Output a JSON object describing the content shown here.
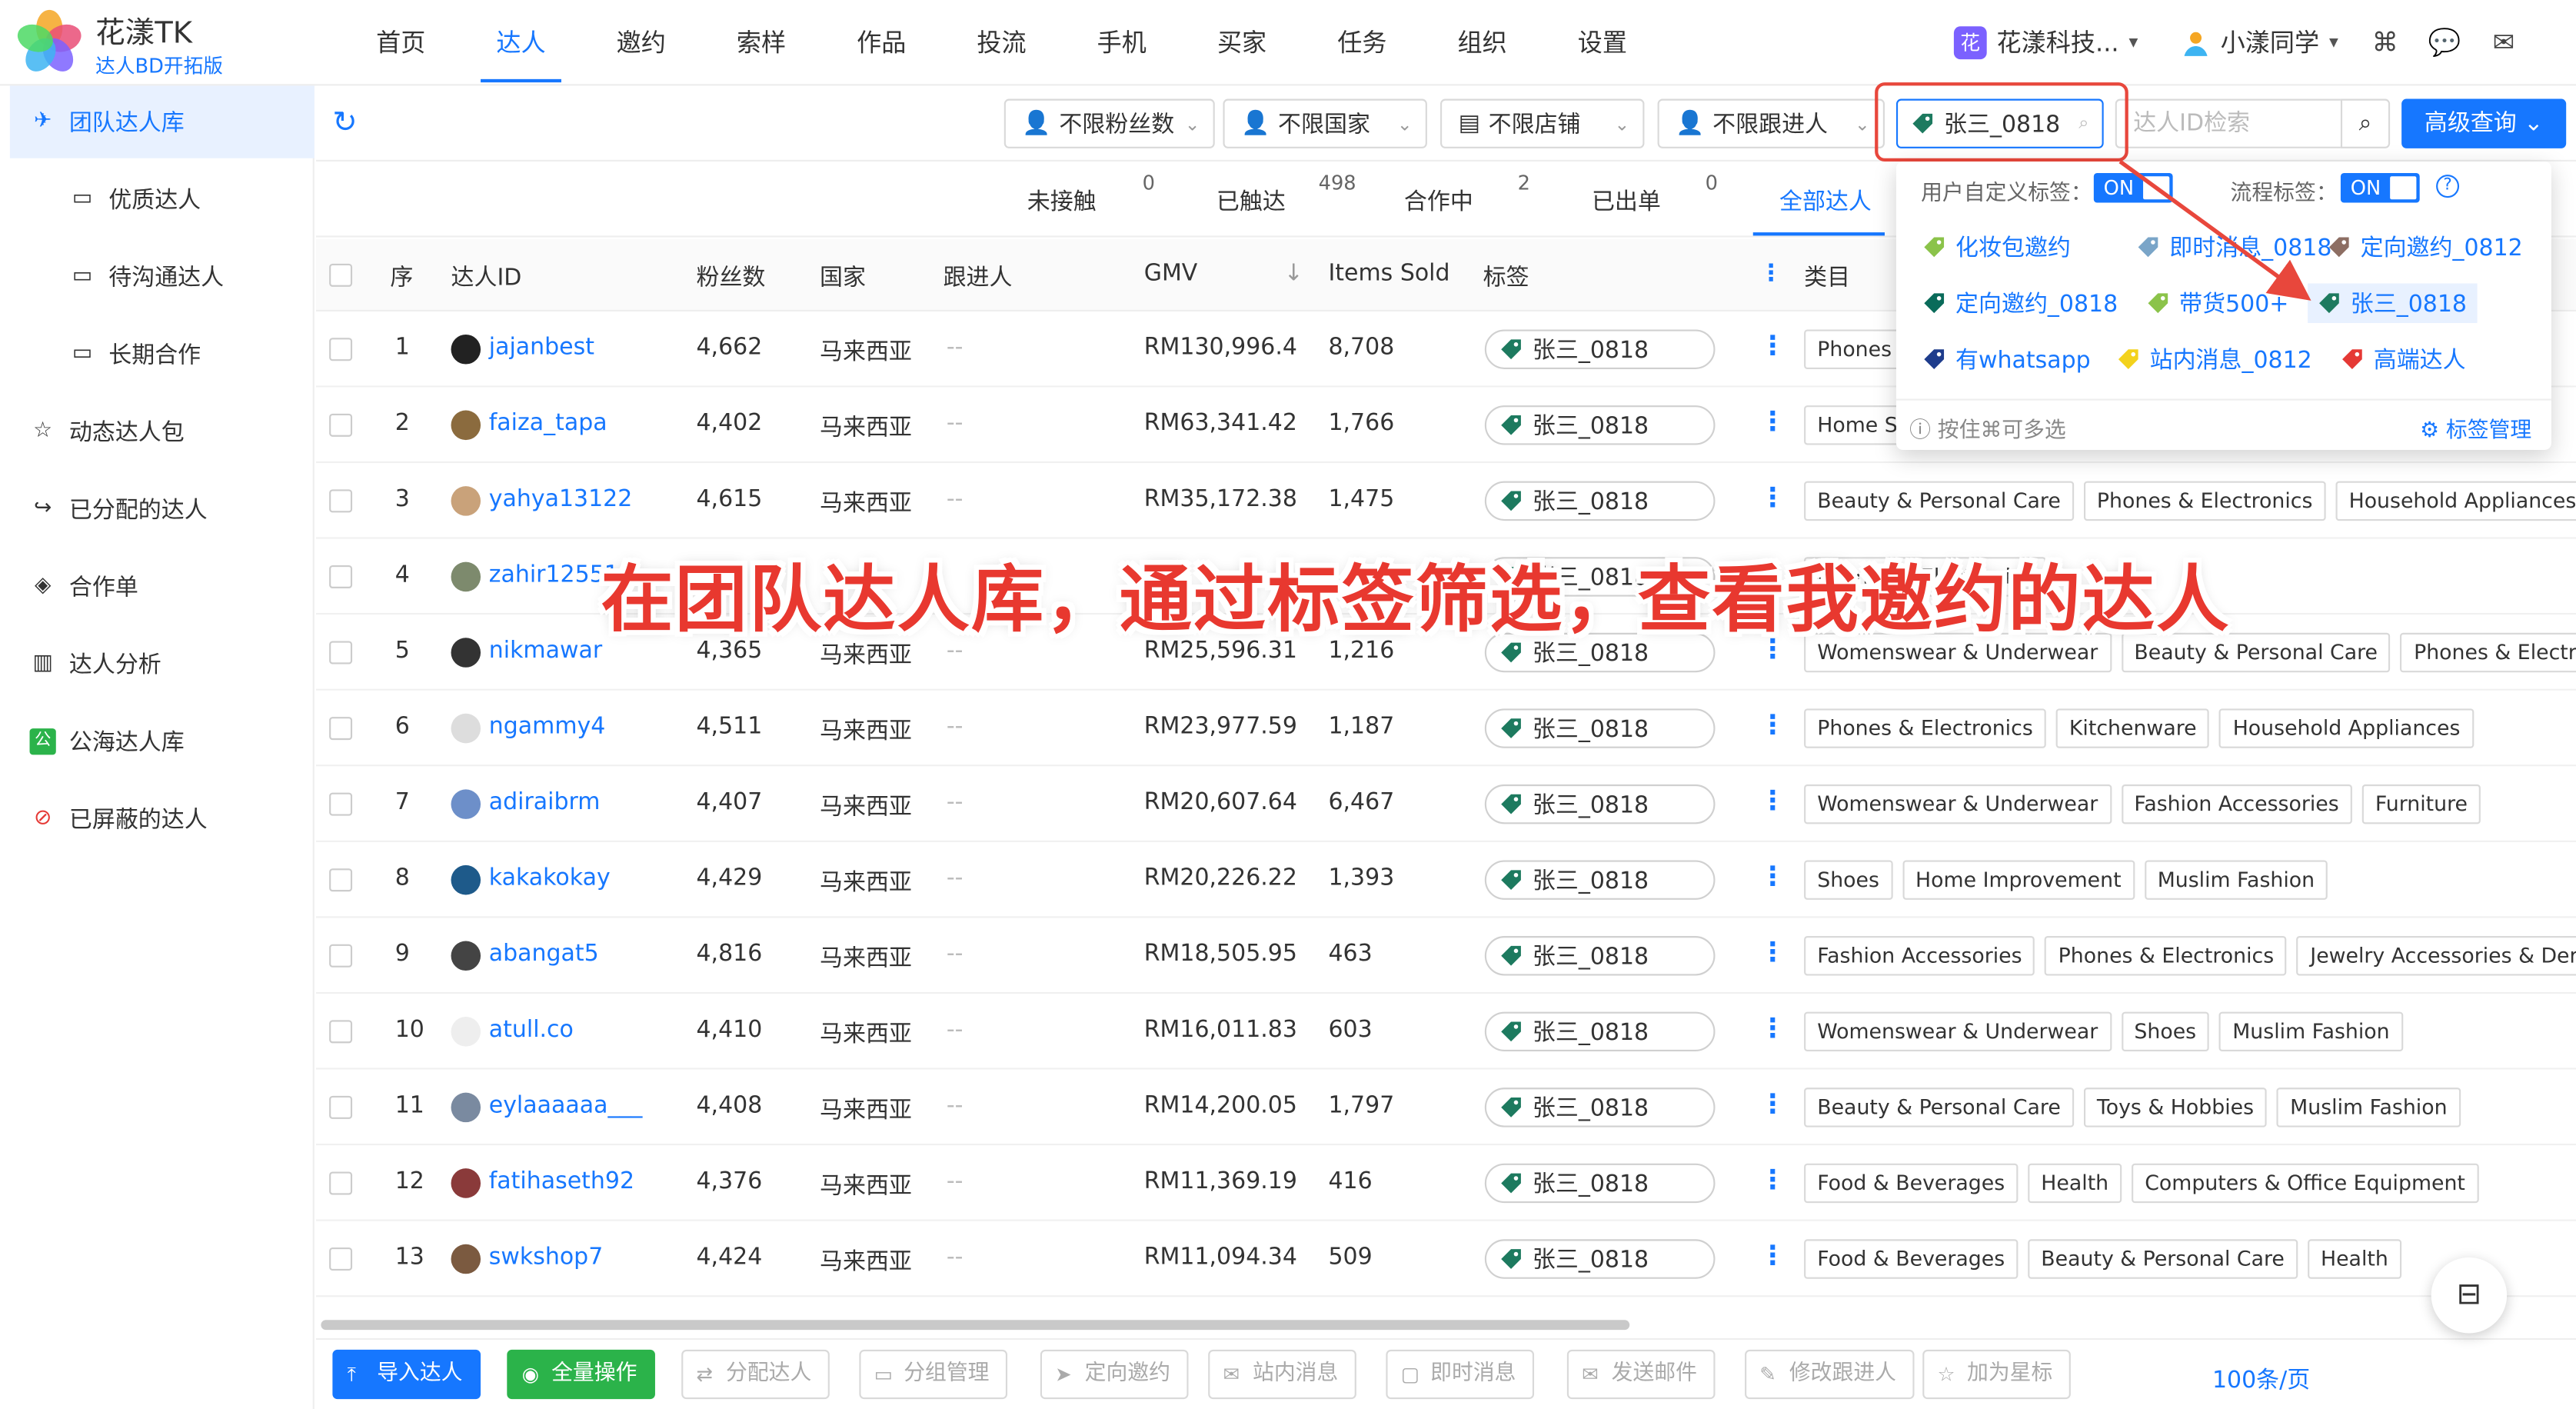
{
  "brand": {
    "title": "花漾TK",
    "subtitle": "达人BD开拓版"
  },
  "nav": [
    "首页",
    "达人",
    "邀约",
    "索样",
    "作品",
    "投流",
    "手机",
    "买家",
    "任务",
    "组织",
    "设置"
  ],
  "header": {
    "org_badge": "花",
    "org_name": "花漾科技...",
    "user_name": "小漾同学"
  },
  "sidebar": [
    {
      "label": "团队达人库",
      "icon": "plane-icon"
    },
    {
      "label": "优质达人",
      "icon": "folder-icon"
    },
    {
      "label": "待沟通达人",
      "icon": "folder-icon"
    },
    {
      "label": "长期合作",
      "icon": "folder-icon"
    },
    {
      "label": "动态达人包",
      "icon": "star-icon"
    },
    {
      "label": "已分配的达人",
      "icon": "share-icon"
    },
    {
      "label": "合作单",
      "icon": "handshake-icon"
    },
    {
      "label": "达人分析",
      "icon": "chart-icon"
    },
    {
      "label": "公海达人库",
      "icon": "public-icon"
    },
    {
      "label": "已屏蔽的达人",
      "icon": "block-icon"
    }
  ],
  "filters": {
    "followers": "不限粉丝数",
    "country": "不限国家",
    "store": "不限店铺",
    "owner": "不限跟进人",
    "tag_value": "张三_0818",
    "id_placeholder": "达人ID检索",
    "advanced": "高级查询"
  },
  "stats": [
    {
      "label": "未接触",
      "count": "0"
    },
    {
      "label": "已触达",
      "count": "498"
    },
    {
      "label": "合作中",
      "count": "2"
    },
    {
      "label": "已出单",
      "count": "0"
    },
    {
      "label": "全部达人",
      "count": ""
    }
  ],
  "table": {
    "headers": {
      "seq": "序",
      "id": "达人ID",
      "fans": "粉丝数",
      "country": "国家",
      "owner": "跟进人",
      "gmv": "GMV",
      "sort": "↓",
      "items": "Items Sold",
      "tag": "标签",
      "cat": "类目"
    },
    "rows": [
      {
        "seq": "1",
        "id": "jajanbest",
        "fans": "4,662",
        "country": "马来西亚",
        "owner": "--",
        "gmv": "RM130,996.4",
        "items": "8,708",
        "tag": "张三_0818",
        "cats": [
          "Phones & Electronics"
        ]
      },
      {
        "seq": "2",
        "id": "faiza_tapa",
        "fans": "4,402",
        "country": "马来西亚",
        "owner": "--",
        "gmv": "RM63,341.42",
        "items": "1,766",
        "tag": "张三_0818",
        "cats": [
          "Home Supplies"
        ]
      },
      {
        "seq": "3",
        "id": "yahya13122",
        "fans": "4,615",
        "country": "马来西亚",
        "owner": "--",
        "gmv": "RM35,172.38",
        "items": "1,475",
        "tag": "张三_0818",
        "cats": [
          "Beauty & Personal Care",
          "Phones & Electronics",
          "Household Appliances"
        ]
      },
      {
        "seq": "4",
        "id": "zahir12551",
        "fans": "",
        "country": "",
        "owner": "",
        "gmv": "",
        "items": "",
        "tag": "张三_0818",
        "cats": [
          "",
          "Phones & Electronics"
        ]
      },
      {
        "seq": "5",
        "id": "nikmawar",
        "fans": "4,365",
        "country": "马来西亚",
        "owner": "--",
        "gmv": "RM25,596.31",
        "items": "1,216",
        "tag": "张三_0818",
        "cats": [
          "Womenswear & Underwear",
          "Beauty & Personal Care",
          "Phones & Electronics"
        ]
      },
      {
        "seq": "6",
        "id": "ngammy4",
        "fans": "4,511",
        "country": "马来西亚",
        "owner": "--",
        "gmv": "RM23,977.59",
        "items": "1,187",
        "tag": "张三_0818",
        "cats": [
          "Phones & Electronics",
          "Kitchenware",
          "Household Appliances"
        ]
      },
      {
        "seq": "7",
        "id": "adiraibrm",
        "fans": "4,407",
        "country": "马来西亚",
        "owner": "--",
        "gmv": "RM20,607.64",
        "items": "6,467",
        "tag": "张三_0818",
        "cats": [
          "Womenswear & Underwear",
          "Fashion Accessories",
          "Furniture"
        ]
      },
      {
        "seq": "8",
        "id": "kakakokay",
        "fans": "4,429",
        "country": "马来西亚",
        "owner": "--",
        "gmv": "RM20,226.22",
        "items": "1,393",
        "tag": "张三_0818",
        "cats": [
          "Shoes",
          "Home Improvement",
          "Muslim Fashion"
        ]
      },
      {
        "seq": "9",
        "id": "abangat5",
        "fans": "4,816",
        "country": "马来西亚",
        "owner": "--",
        "gmv": "RM18,505.95",
        "items": "463",
        "tag": "张三_0818",
        "cats": [
          "Fashion Accessories",
          "Phones & Electronics",
          "Jewelry Accessories & Derivatives"
        ]
      },
      {
        "seq": "10",
        "id": "atull.co",
        "fans": "4,410",
        "country": "马来西亚",
        "owner": "--",
        "gmv": "RM16,011.83",
        "items": "603",
        "tag": "张三_0818",
        "cats": [
          "Womenswear & Underwear",
          "Shoes",
          "Muslim Fashion"
        ]
      },
      {
        "seq": "11",
        "id": "eylaaaaaa___",
        "fans": "4,408",
        "country": "马来西亚",
        "owner": "--",
        "gmv": "RM14,200.05",
        "items": "1,797",
        "tag": "张三_0818",
        "cats": [
          "Beauty & Personal Care",
          "Toys & Hobbies",
          "Muslim Fashion"
        ]
      },
      {
        "seq": "12",
        "id": "fatihaseth92",
        "fans": "4,376",
        "country": "马来西亚",
        "owner": "--",
        "gmv": "RM11,369.19",
        "items": "416",
        "tag": "张三_0818",
        "cats": [
          "Food & Beverages",
          "Health",
          "Computers & Office Equipment"
        ]
      },
      {
        "seq": "13",
        "id": "swkshop7",
        "fans": "4,424",
        "country": "马来西亚",
        "owner": "--",
        "gmv": "RM11,094.34",
        "items": "509",
        "tag": "张三_0818",
        "cats": [
          "Food & Beverages",
          "Beauty & Personal Care",
          "Health"
        ]
      }
    ]
  },
  "popup": {
    "custom_label": "用户自定义标签：",
    "custom_toggle": "ON",
    "flow_label": "流程标签：",
    "flow_toggle": "ON",
    "tags": [
      {
        "label": "化妆包邀约",
        "color": "#8bc34a"
      },
      {
        "label": "即时消息_0818",
        "color": "#7aa5c8"
      },
      {
        "label": "定向邀约_0812",
        "color": "#8d6e63"
      },
      {
        "label": "定向邀约_0818",
        "color": "#0a6b5a"
      },
      {
        "label": "带货500+",
        "color": "#8bc34a"
      },
      {
        "label": "张三_0818",
        "color": "#1d7a5f"
      },
      {
        "label": "有whatsapp",
        "color": "#1e3c8c"
      },
      {
        "label": "站内消息_0812",
        "color": "#f3d21c"
      },
      {
        "label": "高端达人",
        "color": "#e53935"
      }
    ],
    "hint": "按住⌘可多选",
    "manage": "标签管理"
  },
  "caption": "在团队达人库，通过标签筛选，查看我邀约的达人",
  "bottom": {
    "buttons": [
      "导入达人",
      "全量操作",
      "分配达人",
      "分组管理",
      "定向邀约",
      "站内消息",
      "即时消息",
      "发送邮件",
      "修改跟进人",
      "加为星标"
    ],
    "pager": "100条/页"
  },
  "colors": {
    "accent": "#1677ff",
    "highlight": "#e8473c",
    "tag_green": "#1d7a5f"
  }
}
